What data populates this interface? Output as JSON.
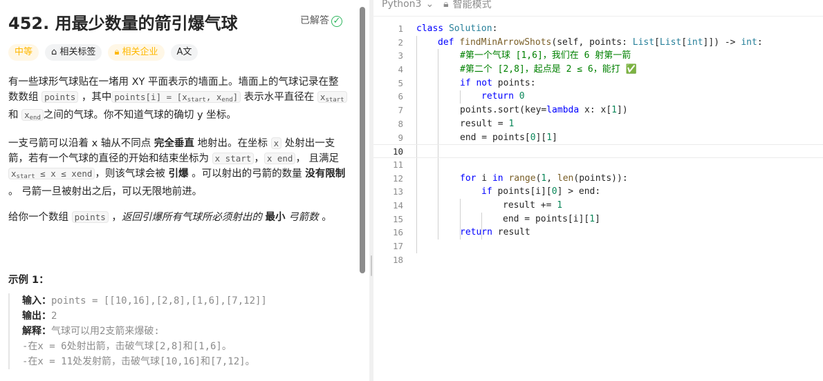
{
  "problem": {
    "title": "452. 用最少数量的箭引爆气球",
    "status": "已解答",
    "tags": {
      "difficulty": "中等",
      "related_tags": "相关标签",
      "related_companies": "相关企业",
      "translate": "A文"
    },
    "para1": {
      "t1": "有一些球形气球贴在一堵用 XY 平面表示的墙面上。墙面上的气球记录在整数数组 ",
      "c1": "points",
      "t2": " ，其中",
      "c2a": "points[i] = [x",
      "c2s": "start",
      "c2b": ", x",
      "c2e": "end",
      "c2c": "]",
      "t3": " 表示水平直径在 ",
      "c3": "x",
      "c3s": "start",
      "t4": " 和 ",
      "c4": "x",
      "c4s": "end",
      "t5": "之间的气球。你不知道气球的确切 y 坐标。"
    },
    "para2": {
      "t1": "一支弓箭可以沿着 x 轴从不同点 ",
      "b1": "完全垂直",
      "t2": " 地射出。在坐标 ",
      "c1": "x",
      "t3": " 处射出一支箭，若有一个气球的直径的开始和结束坐标为 ",
      "c2": "x",
      "c2s": "start",
      "t4": "，",
      "c3": "x",
      "c3s": "end",
      "t5": "， 且满足  ",
      "c4a": "x",
      "c4s": "start",
      "c4b": " ≤ x ≤ x",
      "c4e": "end",
      "t6": "，则该气球会被 ",
      "b2": "引爆",
      "t7": " 。可以射出的弓箭的数量 ",
      "b3": "没有限制",
      "t8": " 。 弓箭一旦被射出之后，可以无限地前进。"
    },
    "para3": {
      "t1": "给你一个数组 ",
      "c1": "points",
      "t2": " ，",
      "i1": "返回引爆所有气球所必须射出的 ",
      "b1": "最小",
      "i2": " 弓箭数",
      "t3": " 。"
    },
    "example_title": "示例 1：",
    "example": {
      "input_label": "输入：",
      "input_value": "points = [[10,16],[2,8],[1,6],[7,12]]",
      "output_label": "输出：",
      "output_value": "2",
      "explain_label": "解释：",
      "explain_value": "气球可以用2支箭来爆破:",
      "line4": "-在x = 6处射出箭，击破气球[2,8]和[1,6]。",
      "line5": "-在x = 11处发射箭，击破气球[10,16]和[7,12]。"
    }
  },
  "editor": {
    "language": "Python3",
    "mode": "智能模式",
    "active_line": 10,
    "lines": [
      {
        "n": "1",
        "indent": 0
      },
      {
        "n": "2",
        "indent": 1
      },
      {
        "n": "3",
        "indent": 2
      },
      {
        "n": "4",
        "indent": 2
      },
      {
        "n": "5",
        "indent": 2
      },
      {
        "n": "6",
        "indent": 3
      },
      {
        "n": "7",
        "indent": 2
      },
      {
        "n": "8",
        "indent": 2
      },
      {
        "n": "9",
        "indent": 2
      },
      {
        "n": "10",
        "indent": 0
      },
      {
        "n": "11",
        "indent": 0
      },
      {
        "n": "12",
        "indent": 2
      },
      {
        "n": "13",
        "indent": 3
      },
      {
        "n": "14",
        "indent": 4
      },
      {
        "n": "15",
        "indent": 4
      },
      {
        "n": "16",
        "indent": 2
      },
      {
        "n": "17",
        "indent": 0
      },
      {
        "n": "18",
        "indent": 0
      }
    ],
    "code": {
      "l1": [
        "class",
        " ",
        "Solution",
        ":"
      ],
      "l2": [
        "def",
        " ",
        "findMinArrowShots",
        "(self, points: ",
        "List",
        "[",
        "List",
        "[",
        "int",
        "]]) -> ",
        "int",
        ":"
      ],
      "l3": "#第一个气球 [1,6]，我们在 6 射第一箭",
      "l4": "#第二个 [2,8]，起点是 2 ≤ 6，能打 ✅",
      "l5": [
        "if",
        " ",
        "not",
        " points:"
      ],
      "l6": [
        "return",
        " ",
        "0"
      ],
      "l7": [
        "points.sort(key=",
        "lambda",
        " x: x[",
        "1",
        "])"
      ],
      "l8": [
        "result = ",
        "1"
      ],
      "l9": [
        "end = points[",
        "0",
        "][",
        "1",
        "]"
      ],
      "l12": [
        "for",
        " i ",
        "in",
        " ",
        "range",
        "(",
        "1",
        ", ",
        "len",
        "(points)):"
      ],
      "l13": [
        "if",
        " points[i][",
        "0",
        "] > end:"
      ],
      "l14": [
        "result += ",
        "1"
      ],
      "l15": [
        "end = points[i][",
        "1",
        "]"
      ],
      "l16": [
        "return",
        " result"
      ]
    }
  }
}
